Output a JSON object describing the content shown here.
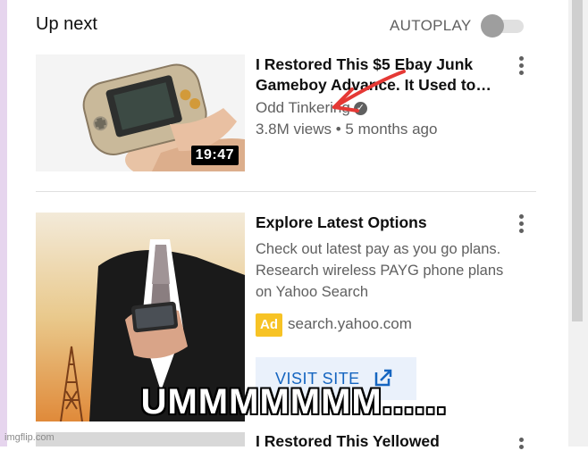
{
  "header": {
    "title": "Up next",
    "autoplay_label": "AUTOPLAY",
    "autoplay_on": false
  },
  "video1": {
    "title": "I Restored This $5 Ebay Junk Gameboy Advance. It Used to…",
    "channel": "Odd Tinkering",
    "verified": true,
    "stats": "3.8M views • 5 months ago",
    "duration": "19:47"
  },
  "ad": {
    "title": "Explore Latest Options",
    "description": "Check out latest pay as you go plans. Research wireless PAYG phone plans on Yahoo Search",
    "badge": "Ad",
    "domain": "search.yahoo.com",
    "button_label": "VISIT SITE"
  },
  "video3": {
    "title": "I Restored This Yellowed"
  },
  "meme_caption": "UMMMMMMM......",
  "watermark": "imgflip.com",
  "colors": {
    "accent_red": "#e53935",
    "ad_yellow": "#f7c325",
    "link_blue": "#1565c0"
  }
}
